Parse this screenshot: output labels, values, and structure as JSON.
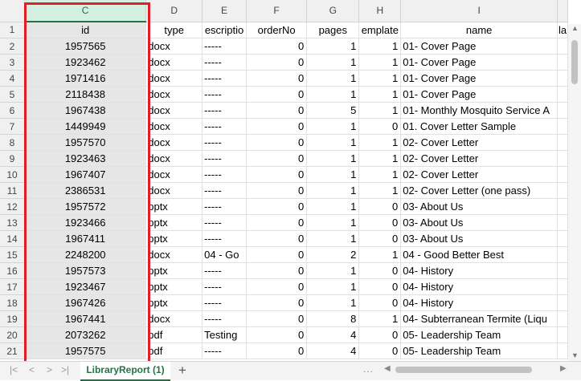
{
  "columns": [
    "C",
    "D",
    "E",
    "F",
    "G",
    "H",
    "I",
    ""
  ],
  "headers": [
    "id",
    "type",
    "escriptio",
    "orderNo",
    "pages",
    "emplate",
    "name",
    "la"
  ],
  "rows": [
    {
      "num": "1"
    },
    {
      "num": "2",
      "id": "1957565",
      "type": "docx",
      "desc": "-----",
      "order": "0",
      "pages": "1",
      "template": "1",
      "name": "01- Cover Page"
    },
    {
      "num": "3",
      "id": "1923462",
      "type": "docx",
      "desc": "-----",
      "order": "0",
      "pages": "1",
      "template": "1",
      "name": "01- Cover Page"
    },
    {
      "num": "4",
      "id": "1971416",
      "type": "docx",
      "desc": "-----",
      "order": "0",
      "pages": "1",
      "template": "1",
      "name": "01- Cover Page"
    },
    {
      "num": "5",
      "id": "2118438",
      "type": "docx",
      "desc": "-----",
      "order": "0",
      "pages": "1",
      "template": "1",
      "name": "01- Cover Page"
    },
    {
      "num": "6",
      "id": "1967438",
      "type": "docx",
      "desc": "-----",
      "order": "0",
      "pages": "5",
      "template": "1",
      "name": "01- Monthly Mosquito Service A"
    },
    {
      "num": "7",
      "id": "1449949",
      "type": "docx",
      "desc": "-----",
      "order": "0",
      "pages": "1",
      "template": "0",
      "name": "01. Cover Letter Sample"
    },
    {
      "num": "8",
      "id": "1957570",
      "type": "docx",
      "desc": "-----",
      "order": "0",
      "pages": "1",
      "template": "1",
      "name": "02- Cover Letter"
    },
    {
      "num": "9",
      "id": "1923463",
      "type": "docx",
      "desc": "-----",
      "order": "0",
      "pages": "1",
      "template": "1",
      "name": "02- Cover Letter"
    },
    {
      "num": "10",
      "id": "1967407",
      "type": "docx",
      "desc": "-----",
      "order": "0",
      "pages": "1",
      "template": "1",
      "name": "02- Cover Letter"
    },
    {
      "num": "11",
      "id": "2386531",
      "type": "docx",
      "desc": "-----",
      "order": "0",
      "pages": "1",
      "template": "1",
      "name": "02- Cover Letter (one pass)"
    },
    {
      "num": "12",
      "id": "1957572",
      "type": "pptx",
      "desc": "-----",
      "order": "0",
      "pages": "1",
      "template": "0",
      "name": "03- About Us"
    },
    {
      "num": "13",
      "id": "1923466",
      "type": "pptx",
      "desc": "-----",
      "order": "0",
      "pages": "1",
      "template": "0",
      "name": "03- About Us"
    },
    {
      "num": "14",
      "id": "1967411",
      "type": "pptx",
      "desc": "-----",
      "order": "0",
      "pages": "1",
      "template": "0",
      "name": "03- About Us"
    },
    {
      "num": "15",
      "id": "2248200",
      "type": "docx",
      "desc": "04 - Go",
      "order": "0",
      "pages": "2",
      "template": "1",
      "name": "04 - Good Better Best"
    },
    {
      "num": "16",
      "id": "1957573",
      "type": "pptx",
      "desc": "-----",
      "order": "0",
      "pages": "1",
      "template": "0",
      "name": "04- History"
    },
    {
      "num": "17",
      "id": "1923467",
      "type": "pptx",
      "desc": "-----",
      "order": "0",
      "pages": "1",
      "template": "0",
      "name": "04- History"
    },
    {
      "num": "18",
      "id": "1967426",
      "type": "pptx",
      "desc": "-----",
      "order": "0",
      "pages": "1",
      "template": "0",
      "name": "04- History"
    },
    {
      "num": "19",
      "id": "1967441",
      "type": "docx",
      "desc": "-----",
      "order": "0",
      "pages": "8",
      "template": "1",
      "name": "04- Subterranean Termite (Liqu"
    },
    {
      "num": "20",
      "id": "2073262",
      "type": "pdf",
      "desc": "Testing",
      "order": "0",
      "pages": "4",
      "template": "0",
      "name": "05- Leadership Team"
    },
    {
      "num": "21",
      "id": "1957575",
      "type": "pdf",
      "desc": "-----",
      "order": "0",
      "pages": "4",
      "template": "0",
      "name": "05- Leadership Team"
    }
  ],
  "sheet_tab": "LibraryReport (1)",
  "add_sheet_label": "+",
  "nav": {
    "first": "|<",
    "prev": "<",
    "next": ">",
    "last": ">|"
  },
  "dots": "...",
  "accent_color": "#217346",
  "highlight_color": "#e01e26"
}
